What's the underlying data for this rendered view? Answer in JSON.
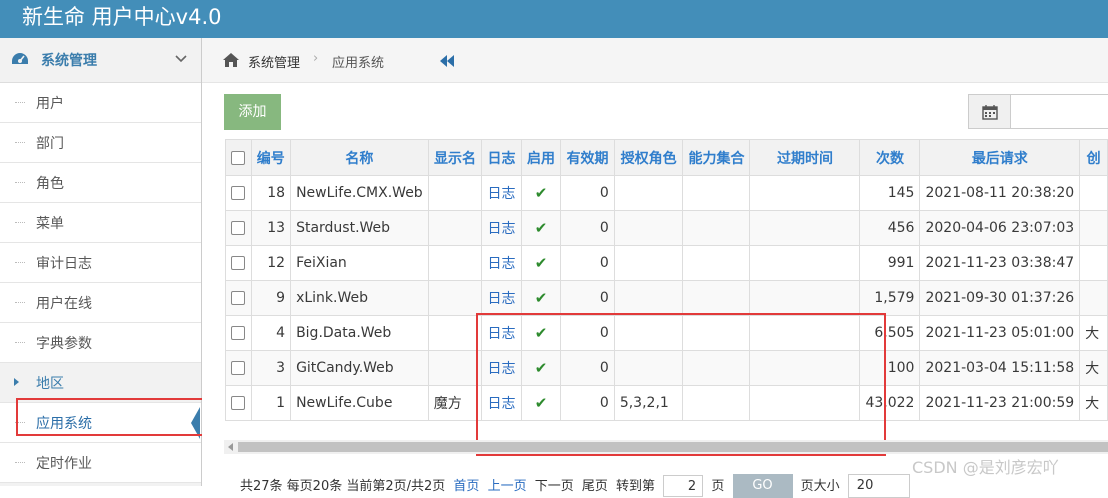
{
  "app": {
    "title": "新生命 用户中心v4.0"
  },
  "sidebar": {
    "section_title": "系统管理",
    "items": [
      {
        "label": "用户",
        "type": "leaf"
      },
      {
        "label": "部门",
        "type": "leaf"
      },
      {
        "label": "角色",
        "type": "leaf"
      },
      {
        "label": "菜单",
        "type": "leaf"
      },
      {
        "label": "审计日志",
        "type": "leaf"
      },
      {
        "label": "用户在线",
        "type": "leaf"
      },
      {
        "label": "字典参数",
        "type": "leaf"
      },
      {
        "label": "地区",
        "type": "group"
      },
      {
        "label": "应用系统",
        "type": "active"
      },
      {
        "label": "定时作业",
        "type": "leaf"
      }
    ]
  },
  "breadcrumb": {
    "parent": "系统管理",
    "separator": "›",
    "current": "应用系统"
  },
  "toolbar": {
    "add_label": "添加"
  },
  "table": {
    "columns": [
      "",
      "编号",
      "名称",
      "显示名",
      "日志",
      "启用",
      "有效期",
      "授权角色",
      "能力集合",
      "过期时间",
      "次数",
      "最后请求",
      "创"
    ],
    "rows": [
      {
        "id": "18",
        "name": "NewLife.CMX.Web",
        "display": "",
        "log": "日志",
        "enabled": "✔",
        "validity": "0",
        "roles": "",
        "abilities": "",
        "expire": "",
        "count": "145",
        "last": "2021-08-11 20:38:20",
        "extra": ""
      },
      {
        "id": "13",
        "name": "Stardust.Web",
        "display": "",
        "log": "日志",
        "enabled": "✔",
        "validity": "0",
        "roles": "",
        "abilities": "",
        "expire": "",
        "count": "456",
        "last": "2020-04-06 23:07:03",
        "extra": ""
      },
      {
        "id": "12",
        "name": "FeiXian",
        "display": "",
        "log": "日志",
        "enabled": "✔",
        "validity": "0",
        "roles": "",
        "abilities": "",
        "expire": "",
        "count": "991",
        "last": "2021-11-23 03:38:47",
        "extra": ""
      },
      {
        "id": "9",
        "name": "xLink.Web",
        "display": "",
        "log": "日志",
        "enabled": "✔",
        "validity": "0",
        "roles": "",
        "abilities": "",
        "expire": "",
        "count": "1,579",
        "last": "2021-09-30 01:37:26",
        "extra": ""
      },
      {
        "id": "4",
        "name": "Big.Data.Web",
        "display": "",
        "log": "日志",
        "enabled": "✔",
        "validity": "0",
        "roles": "",
        "abilities": "",
        "expire": "",
        "count": "6,505",
        "last": "2021-11-23 05:01:00",
        "extra": "大"
      },
      {
        "id": "3",
        "name": "GitCandy.Web",
        "display": "",
        "log": "日志",
        "enabled": "✔",
        "validity": "0",
        "roles": "",
        "abilities": "",
        "expire": "",
        "count": "100",
        "last": "2021-03-04 15:11:58",
        "extra": "大"
      },
      {
        "id": "1",
        "name": "NewLife.Cube",
        "display": "魔方",
        "log": "日志",
        "enabled": "✔",
        "validity": "0",
        "roles": "5,3,2,1",
        "abilities": "",
        "expire": "",
        "count": "43,022",
        "last": "2021-11-23 21:00:59",
        "extra": "大"
      }
    ]
  },
  "pager": {
    "summary": "共27条 每页20条 当前第2页/共2页",
    "first": "首页",
    "prev": "上一页",
    "next": "下一页",
    "last": "尾页",
    "goto_label": "转到第",
    "goto_value": "2",
    "page_unit": "页",
    "go_label": "GO",
    "size_label": "页大小",
    "size_value": "20"
  },
  "watermark": "CSDN @是刘彦宏吖",
  "colors": {
    "topbar": "#438eb9",
    "accent": "#307ecc",
    "add_button": "#87b87f",
    "highlight_box": "#e23a3a",
    "check": "#2e8b2e"
  }
}
